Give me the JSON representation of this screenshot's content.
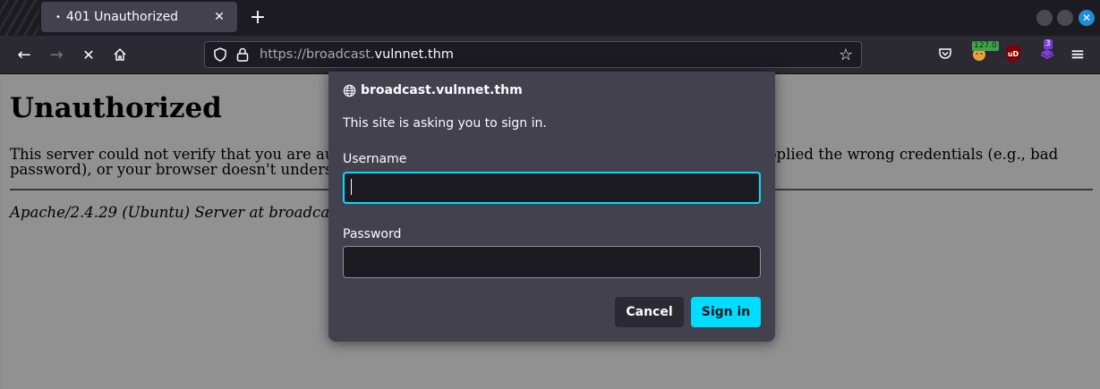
{
  "tab": {
    "title": "401 Unauthorized",
    "loading_dot": "•",
    "close_glyph": "✕",
    "new_tab_glyph": "+"
  },
  "nav": {
    "back_glyph": "←",
    "forward_glyph": "→",
    "stop_glyph": "✕",
    "home_icon": "home-icon",
    "url_scheme": "https://broadcast.",
    "url_host": "vulnnet.thm",
    "bookmark_glyph": "☆"
  },
  "extensions": {
    "counter_badge": "127.0",
    "ublock_label": "uD",
    "purple_badge": "3",
    "menu_glyph": "≡"
  },
  "window": {
    "close_glyph": "✕"
  },
  "page": {
    "heading": "Unauthorized",
    "message": "This server could not verify that you are authorized to access the document requested. Either you supplied the wrong credentials (e.g., bad password), or your browser doesn't understand how to supply the credentials required.",
    "address": "Apache/2.4.29 (Ubuntu) Server at broadcast.vulnnet.thm Port 80"
  },
  "dialog": {
    "host": "broadcast.vulnnet.thm",
    "prompt": "This site is asking you to sign in.",
    "username_label": "Username",
    "username_value": "",
    "password_label": "Password",
    "password_value": "",
    "cancel_label": "Cancel",
    "signin_label": "Sign in"
  },
  "colors": {
    "accent": "#00ddff",
    "dialog_bg": "#42414d",
    "toolbar_bg": "#2b2a33"
  }
}
